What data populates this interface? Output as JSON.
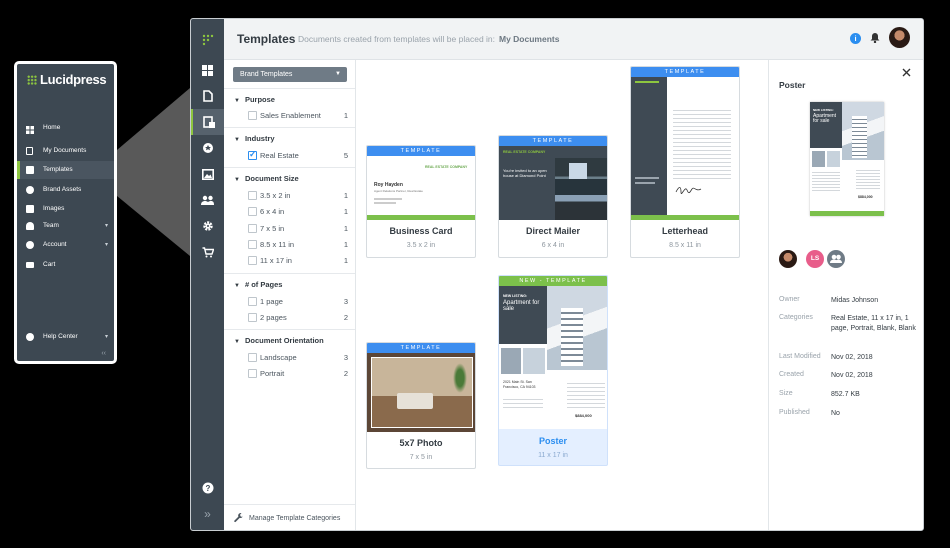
{
  "callout": {
    "logo": "Lucidpress",
    "items": [
      {
        "label": "Home",
        "icon": "grid-icon"
      },
      {
        "label": "My Documents",
        "icon": "document-icon"
      },
      {
        "label": "Templates",
        "icon": "templates-icon",
        "active": true
      },
      {
        "label": "Brand Assets",
        "icon": "brand-icon"
      },
      {
        "label": "Images",
        "icon": "image-icon"
      },
      {
        "label": "Team",
        "icon": "team-icon"
      },
      {
        "label": "Account",
        "icon": "gear-icon"
      },
      {
        "label": "Cart",
        "icon": "cart-icon"
      },
      {
        "label": "Help Center",
        "icon": "help-icon"
      }
    ],
    "collapse": "‹‹"
  },
  "header": {
    "title": "Templates",
    "subtitle": "Documents created from templates will be placed in:",
    "destination": "My Documents",
    "info": "i"
  },
  "filters": {
    "brand_dropdown": "Brand Templates",
    "sections": [
      {
        "title": "Purpose",
        "rows": [
          {
            "label": "Sales Enablement",
            "count": "1",
            "checked": false
          }
        ]
      },
      {
        "title": "Industry",
        "rows": [
          {
            "label": "Real Estate",
            "count": "5",
            "checked": true
          }
        ]
      },
      {
        "title": "Document Size",
        "rows": [
          {
            "label": "3.5 x 2 in",
            "count": "1"
          },
          {
            "label": "6 x 4 in",
            "count": "1"
          },
          {
            "label": "7 x 5 in",
            "count": "1"
          },
          {
            "label": "8.5 x 11 in",
            "count": "1"
          },
          {
            "label": "11 x 17 in",
            "count": "1"
          }
        ]
      },
      {
        "title": "# of Pages",
        "rows": [
          {
            "label": "1 page",
            "count": "3"
          },
          {
            "label": "2 pages",
            "count": "2"
          }
        ]
      },
      {
        "title": "Document Orientation",
        "rows": [
          {
            "label": "Landscape",
            "count": "3"
          },
          {
            "label": "Portrait",
            "count": "2"
          }
        ]
      }
    ],
    "manage": "Manage Template Categories"
  },
  "templates": [
    {
      "name": "Business Card",
      "size": "3.5 x 2 in",
      "badge": "TEMPLATE"
    },
    {
      "name": "Direct Mailer",
      "size": "6 x 4 in",
      "badge": "TEMPLATE"
    },
    {
      "name": "Letterhead",
      "size": "8.5 x 11 in",
      "badge": "TEMPLATE"
    },
    {
      "name": "5x7 Photo",
      "size": "7 x 5 in",
      "badge": "TEMPLATE"
    },
    {
      "name": "Poster",
      "size": "11 x 17 in",
      "badge": "NEW - TEMPLATE"
    }
  ],
  "thumbs": {
    "business_card": {
      "company": "REAL ESTATE COMPANY",
      "person": "Roy Hayden",
      "role": "Agent Relations Partner, Real Estate"
    },
    "mailer": {
      "company": "REAL ESTATE COMPANY",
      "headline": "You're invited to an open house at Diamond Point"
    },
    "poster": {
      "tag": "NEW LISTING:",
      "headline": "Apartment for sale",
      "address": "2021 Main St. San Francisco, CA 94103",
      "price": "$884,000"
    }
  },
  "details": {
    "title": "Poster",
    "owner_label": "Owner",
    "owner": "Midas Johnson",
    "categories_label": "Categories",
    "categories": "Real Estate, 11 x 17 in, 1 page, Portrait, Blank, Blank",
    "modified_label": "Last Modified",
    "modified": "Nov 02, 2018",
    "created_label": "Created",
    "created": "Nov 02, 2018",
    "size_label": "Size",
    "size": "852.7 KB",
    "published_label": "Published",
    "published": "No",
    "share_initials": "LS"
  },
  "colors": {
    "accent": "#8dc63f",
    "blue": "#3d8ef0",
    "sidebar": "#3d4852",
    "green_bar": "#7cc04b"
  }
}
